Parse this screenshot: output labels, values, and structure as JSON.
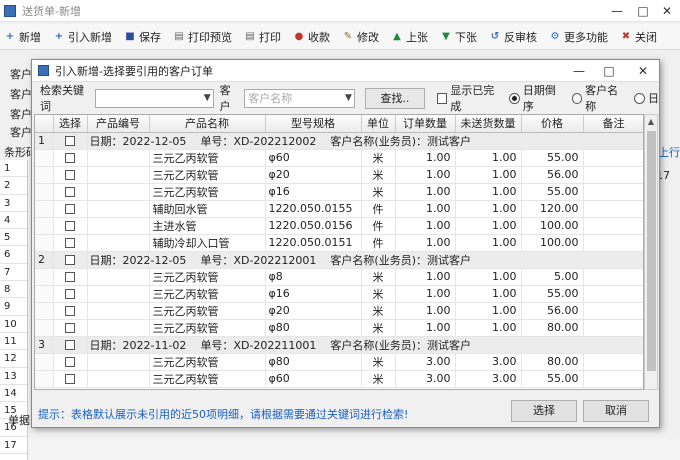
{
  "main": {
    "title": "送货单-新增",
    "window_controls": [
      "—",
      "□",
      "✕"
    ],
    "toolbar": [
      {
        "label": "新增",
        "icon": "add-icon",
        "color": "#2b6cc4"
      },
      {
        "label": "引入新增",
        "icon": "import-icon",
        "color": "#2b6cc4"
      },
      {
        "label": "保存",
        "icon": "save-icon",
        "color": "#2b4f9e"
      },
      {
        "label": "打印预览",
        "icon": "print-preview-icon",
        "color": "#666666"
      },
      {
        "label": "打印",
        "icon": "print-icon",
        "color": "#666666"
      },
      {
        "label": "收款",
        "icon": "receipt-icon",
        "color": "#c0392b"
      },
      {
        "label": "修改",
        "icon": "edit-icon",
        "color": "#8a6d1e"
      },
      {
        "label": "上张",
        "icon": "up-arrow-icon",
        "color": "#1f8a3b"
      },
      {
        "label": "下张",
        "icon": "down-arrow-icon",
        "color": "#1f8a3b"
      },
      {
        "label": "反审核",
        "icon": "unapprove-icon",
        "color": "#2b6cc4"
      },
      {
        "label": "更多功能",
        "icon": "more-icon",
        "color": "#2b6cc4"
      },
      {
        "label": "关闭",
        "icon": "close-icon",
        "color": "#c0392b"
      }
    ],
    "bg_labels": [
      "客户",
      "客户",
      "客户",
      "客户"
    ],
    "tab_label": "条形码",
    "row_numbers": [
      "1",
      "2",
      "3",
      "4",
      "5",
      "6",
      "7",
      "8",
      "9",
      "10",
      "11",
      "12",
      "13",
      "14",
      "15",
      "16",
      "17"
    ],
    "right_link": "上行",
    "pager": "17",
    "status": "单据"
  },
  "dialog": {
    "title": "引入新增-选择要引用的客户订单",
    "window_controls": [
      "—",
      "□",
      "✕"
    ],
    "search": {
      "keyword_label": "检索关键词",
      "keyword_value": "",
      "customer_label": "客户",
      "customer_placeholder": "客户名称",
      "query_button": "查找..",
      "show_completed": "显示已完成",
      "sort_date_desc": "日期倒序",
      "sort_customer": "客户名称",
      "sort_third": "日"
    },
    "columns": [
      "选择",
      "产品编号",
      "产品名称",
      "型号规格",
      "单位",
      "订单数量",
      "未送货数量",
      "价格",
      "备注"
    ],
    "groups": [
      {
        "no": "1",
        "date_label": "日期：",
        "date": "2022-12-05",
        "order_label": "单号：",
        "order_no": "XD-202212002",
        "customer_label": "客户名称(业务员)：",
        "customer": "测试客户",
        "rows": [
          {
            "name": "三元乙丙软管",
            "spec": "φ60",
            "unit": "米",
            "qty": "1.00",
            "pending": "1.00",
            "price": "55.00"
          },
          {
            "name": "三元乙丙软管",
            "spec": "φ20",
            "unit": "米",
            "qty": "1.00",
            "pending": "1.00",
            "price": "56.00"
          },
          {
            "name": "三元乙丙软管",
            "spec": "φ16",
            "unit": "米",
            "qty": "1.00",
            "pending": "1.00",
            "price": "55.00"
          },
          {
            "name": "辅助回水管",
            "spec": "1220.050.0155",
            "unit": "件",
            "qty": "1.00",
            "pending": "1.00",
            "price": "120.00"
          },
          {
            "name": "主进水管",
            "spec": "1220.050.0156",
            "unit": "件",
            "qty": "1.00",
            "pending": "1.00",
            "price": "100.00"
          },
          {
            "name": "辅助冷却入口管",
            "spec": "1220.050.0151",
            "unit": "件",
            "qty": "1.00",
            "pending": "1.00",
            "price": "100.00"
          }
        ]
      },
      {
        "no": "2",
        "date_label": "日期：",
        "date": "2022-12-05",
        "order_label": "单号：",
        "order_no": "XD-202212001",
        "customer_label": "客户名称(业务员)：",
        "customer": "测试客户",
        "rows": [
          {
            "name": "三元乙丙软管",
            "spec": "φ8",
            "unit": "米",
            "qty": "1.00",
            "pending": "1.00",
            "price": "5.00"
          },
          {
            "name": "三元乙丙软管",
            "spec": "φ16",
            "unit": "米",
            "qty": "1.00",
            "pending": "1.00",
            "price": "55.00"
          },
          {
            "name": "三元乙丙软管",
            "spec": "φ20",
            "unit": "米",
            "qty": "1.00",
            "pending": "1.00",
            "price": "56.00"
          },
          {
            "name": "三元乙丙软管",
            "spec": "φ80",
            "unit": "米",
            "qty": "1.00",
            "pending": "1.00",
            "price": "80.00"
          }
        ]
      },
      {
        "no": "3",
        "date_label": "日期：",
        "date": "2022-11-02",
        "order_label": "单号：",
        "order_no": "XD-202211001",
        "customer_label": "客户名称(业务员)：",
        "customer": "测试客户",
        "rows": [
          {
            "name": "三元乙丙软管",
            "spec": "φ80",
            "unit": "米",
            "qty": "3.00",
            "pending": "3.00",
            "price": "80.00"
          },
          {
            "name": "三元乙丙软管",
            "spec": "φ60",
            "unit": "米",
            "qty": "3.00",
            "pending": "3.00",
            "price": "55.00"
          }
        ]
      }
    ],
    "hint": "提示：表格默认展示未引用的近50项明细，请根据需要通过关键词进行检索!",
    "select_button": "选择",
    "cancel_button": "取消"
  }
}
